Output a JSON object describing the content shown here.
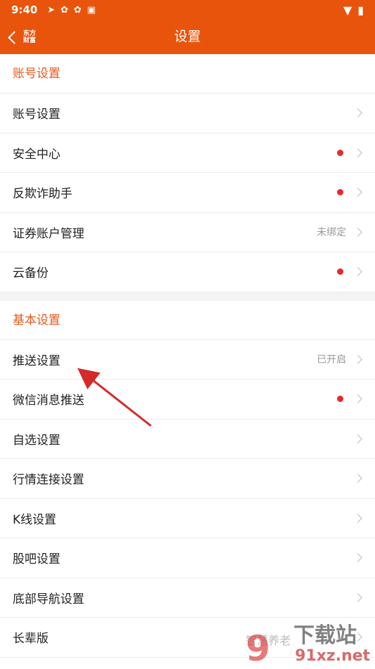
{
  "status_bar": {
    "time": "9:40"
  },
  "nav": {
    "title": "设置",
    "logo_line1": "东方",
    "logo_line2": "财富"
  },
  "sections": [
    {
      "header": "账号设置",
      "items": [
        {
          "label": "账号设置",
          "value": "",
          "dot": false
        },
        {
          "label": "安全中心",
          "value": "",
          "dot": true
        },
        {
          "label": "反欺诈助手",
          "value": "",
          "dot": true
        },
        {
          "label": "证券账户管理",
          "value": "未绑定",
          "dot": false
        },
        {
          "label": "云备份",
          "value": "",
          "dot": true
        }
      ]
    },
    {
      "header": "基本设置",
      "items": [
        {
          "label": "推送设置",
          "value": "已开启",
          "dot": false
        },
        {
          "label": "微信消息推送",
          "value": "",
          "dot": true
        },
        {
          "label": "自选设置",
          "value": "",
          "dot": false
        },
        {
          "label": "行情连接设置",
          "value": "",
          "dot": false
        },
        {
          "label": "K线设置",
          "value": "",
          "dot": false
        },
        {
          "label": "股吧设置",
          "value": "",
          "dot": false
        },
        {
          "label": "底部导航设置",
          "value": "",
          "dot": false
        },
        {
          "label": "长辈版",
          "value": "",
          "dot": false
        }
      ]
    }
  ],
  "watermark": {
    "text": "下载站",
    "url": "91xz.net",
    "mark": "9",
    "faded": "智慧养老"
  }
}
